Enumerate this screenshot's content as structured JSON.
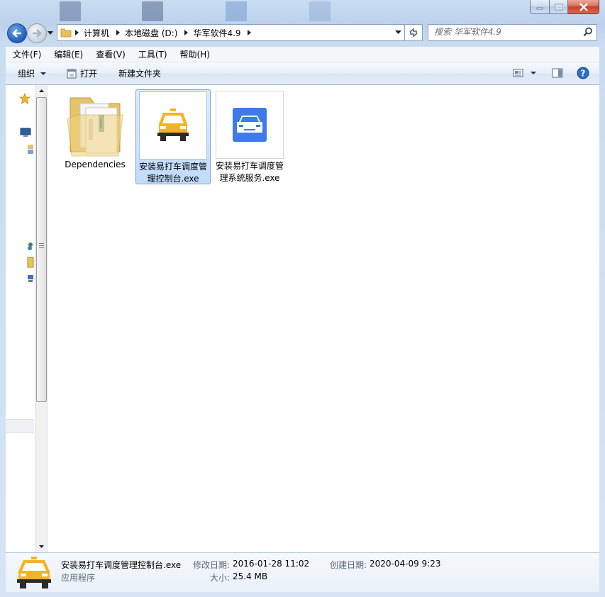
{
  "address": {
    "crumbs": [
      "计算机",
      "本地磁盘 (D:)",
      "华军软件4.9"
    ]
  },
  "search": {
    "placeholder": "搜索 华军软件4.9"
  },
  "menu": [
    "文件(F)",
    "编辑(E)",
    "查看(V)",
    "工具(T)",
    "帮助(H)"
  ],
  "toolbar": {
    "organize_label": "组织",
    "open_label": "打开",
    "new_folder_label": "新建文件夹"
  },
  "files": [
    {
      "name": "Dependencies",
      "type": "folder",
      "selected": false
    },
    {
      "name": "安装易打车调度管理控制台.exe",
      "type": "exe-taxi",
      "selected": true
    },
    {
      "name": "安装易打车调度管理系统服务.exe",
      "type": "exe-car",
      "selected": false
    }
  ],
  "details": {
    "name": "安装易打车调度管理控制台.exe",
    "kind": "应用程序",
    "modified_label": "修改日期:",
    "modified_value": "2016-01-28 11:02",
    "created_label": "创建日期:",
    "created_value": "2020-04-09 9:23",
    "size_label": "大小:",
    "size_value": "25.4 MB"
  },
  "colors": {
    "selection": "#c1dbfc",
    "taxi_yellow": "#f5b323",
    "car_blue": "#3c7be8",
    "close_red": "#c5412a"
  }
}
